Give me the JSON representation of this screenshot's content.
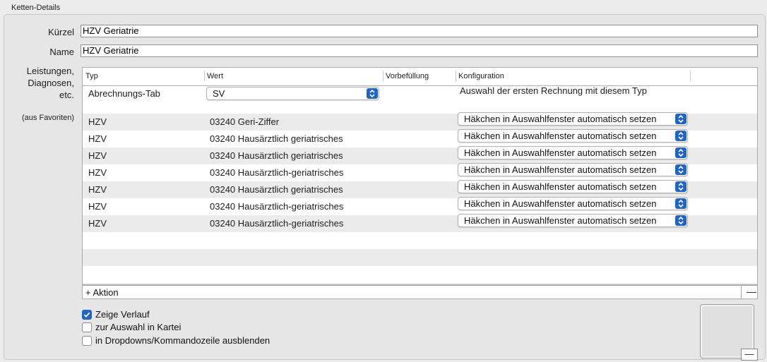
{
  "group": {
    "title": "Ketten-Details"
  },
  "fields": {
    "kuerzel": {
      "label": "Kürzel",
      "value": "HZV Geriatrie"
    },
    "name": {
      "label": "Name",
      "value": "HZV Geriatrie"
    }
  },
  "side_labels": {
    "leistungen": "Leistungen,",
    "diagnosen": "Diagnosen,",
    "etc": "etc.",
    "favoriten": "(aus Favoriten)"
  },
  "table": {
    "columns": [
      "Typ",
      "Wert",
      "Vorbefüllung",
      "Konfiguration"
    ],
    "first_row": {
      "typ": "Abrechnungs-Tab",
      "wert": "SV",
      "konfiguration": "Auswahl der ersten Rechnung mit diesem Typ"
    },
    "rows": [
      {
        "typ": "HZV",
        "wert": "03240 Geri-Ziffer",
        "konfiguration": "Häkchen in Auswahlfenster automatisch setzen"
      },
      {
        "typ": "HZV",
        "wert": "03240 Hausärztlich geriatrisches",
        "konfiguration": "Häkchen in Auswahlfenster automatisch setzen"
      },
      {
        "typ": "HZV",
        "wert": "03240 Hausärztlich geriatrisches",
        "konfiguration": "Häkchen in Auswahlfenster automatisch setzen"
      },
      {
        "typ": "HZV",
        "wert": "03240 Hausärztlich-geriatrisches",
        "konfiguration": "Häkchen in Auswahlfenster automatisch setzen"
      },
      {
        "typ": "HZV",
        "wert": "03240 Hausärztlich geriatrisches",
        "konfiguration": "Häkchen in Auswahlfenster automatisch setzen"
      },
      {
        "typ": "HZV",
        "wert": "03240 Hausärztlich-geriatrisches",
        "konfiguration": "Häkchen in Auswahlfenster automatisch setzen"
      },
      {
        "typ": "HZV",
        "wert": "03240 Hausärztlich-geriatrisches",
        "konfiguration": "Häkchen in Auswahlfenster automatisch setzen"
      }
    ],
    "add_action_label": "+ Aktion",
    "remove_label": "—"
  },
  "checkboxes": [
    {
      "label": "Zeige Verlauf",
      "checked": true
    },
    {
      "label": "zur Auswahl in Kartei",
      "checked": false
    },
    {
      "label": "in Dropdowns/Kommandozeile ausblenden",
      "checked": false
    }
  ],
  "image_well": {
    "remove_label": "—"
  },
  "colors": {
    "accent": "#1f65c8"
  }
}
